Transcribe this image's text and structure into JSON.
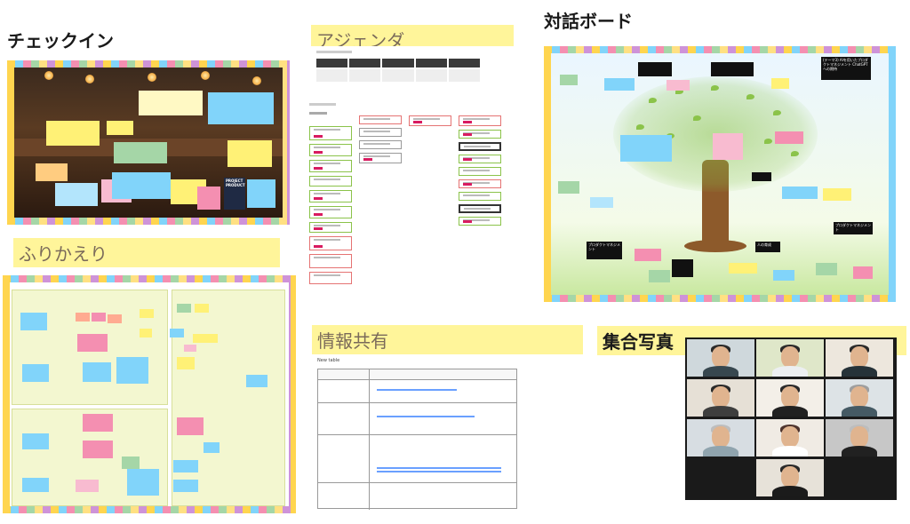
{
  "sections": {
    "checkin": "チェックイン",
    "agenda": "アジェンダ",
    "dialog_board": "対話ボード",
    "reflection": "ふりかえり",
    "info_share": "情報共有",
    "group_photo": "集合写真"
  },
  "info_share": {
    "table_label": "New table"
  },
  "dialog_board": {
    "notes": [
      "(テーマ3) AIを用いたプロダクトマネジメント ChatGPTへの期待",
      "人の育成",
      "プロダクトマネジメント",
      "プロダクトマネジメント"
    ]
  },
  "checkin": {
    "poster": "PROJECT PRODUCT"
  },
  "colors": {
    "highlight": "#fff59a",
    "sticky_yellow": "#fff176",
    "sticky_pink": "#f8bbd0",
    "sticky_blue": "#81d4fa",
    "sticky_green": "#a5d6a7"
  }
}
